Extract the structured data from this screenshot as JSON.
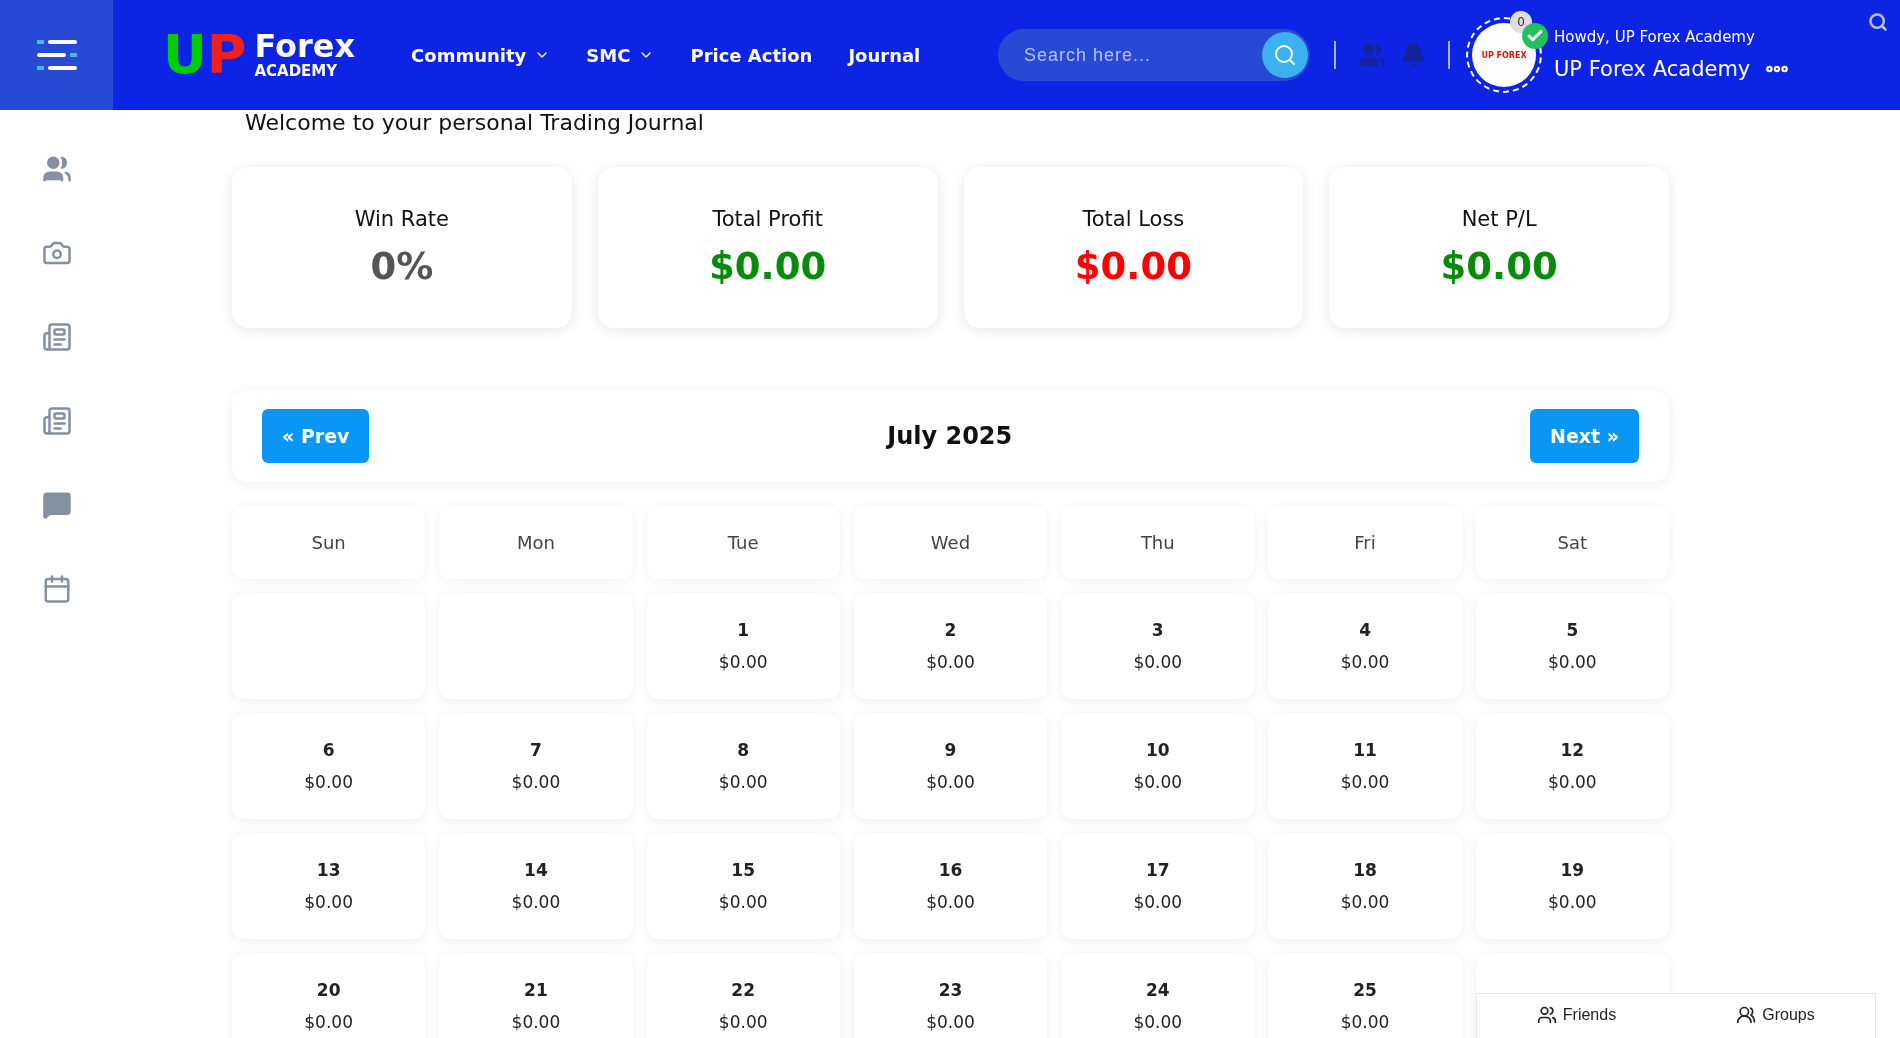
{
  "header": {
    "logo": {
      "mark_left": "U",
      "mark_right": "P",
      "word": "Forex",
      "sub": "ACADEMY"
    },
    "nav": [
      {
        "label": "Community",
        "dropdown": true
      },
      {
        "label": "SMC",
        "dropdown": true
      },
      {
        "label": "Price Action",
        "dropdown": false
      },
      {
        "label": "Journal",
        "dropdown": false
      }
    ],
    "search": {
      "placeholder": "Search here..."
    },
    "notification_count": "0",
    "verified": true,
    "greeting": "Howdy, UP Forex Academy",
    "user_name": "UP Forex Academy",
    "avatar_text": "UP FOREX"
  },
  "sidebar": {
    "items": [
      {
        "kind": "people"
      },
      {
        "kind": "camera"
      },
      {
        "kind": "news"
      },
      {
        "kind": "news"
      },
      {
        "kind": "chat"
      },
      {
        "kind": "calendar"
      }
    ]
  },
  "intro": "Welcome to your personal Trading Journal",
  "stats": [
    {
      "label": "Win Rate",
      "value": "0%",
      "color": "#555555"
    },
    {
      "label": "Total Profit",
      "value": "$0.00",
      "color": "#0a8a0a"
    },
    {
      "label": "Total Loss",
      "value": "$0.00",
      "color": "#ff0000"
    },
    {
      "label": "Net P/L",
      "value": "$0.00",
      "color": "#0a8a0a"
    }
  ],
  "calendar": {
    "prev": "« Prev",
    "month": "July 2025",
    "next": "Next »",
    "weekdays": [
      "Sun",
      "Mon",
      "Tue",
      "Wed",
      "Thu",
      "Fri",
      "Sat"
    ],
    "cells": [
      {},
      {},
      {
        "day": "1",
        "amount": "$0.00"
      },
      {
        "day": "2",
        "amount": "$0.00"
      },
      {
        "day": "3",
        "amount": "$0.00"
      },
      {
        "day": "4",
        "amount": "$0.00"
      },
      {
        "day": "5",
        "amount": "$0.00"
      },
      {
        "day": "6",
        "amount": "$0.00"
      },
      {
        "day": "7",
        "amount": "$0.00"
      },
      {
        "day": "8",
        "amount": "$0.00"
      },
      {
        "day": "9",
        "amount": "$0.00"
      },
      {
        "day": "10",
        "amount": "$0.00"
      },
      {
        "day": "11",
        "amount": "$0.00"
      },
      {
        "day": "12",
        "amount": "$0.00"
      },
      {
        "day": "13",
        "amount": "$0.00"
      },
      {
        "day": "14",
        "amount": "$0.00"
      },
      {
        "day": "15",
        "amount": "$0.00"
      },
      {
        "day": "16",
        "amount": "$0.00"
      },
      {
        "day": "17",
        "amount": "$0.00"
      },
      {
        "day": "18",
        "amount": "$0.00"
      },
      {
        "day": "19",
        "amount": "$0.00"
      },
      {
        "day": "20",
        "amount": "$0.00"
      },
      {
        "day": "21",
        "amount": "$0.00"
      },
      {
        "day": "22",
        "amount": "$0.00"
      },
      {
        "day": "23",
        "amount": "$0.00"
      },
      {
        "day": "24",
        "amount": "$0.00"
      },
      {
        "day": "25",
        "amount": "$0.00"
      },
      {}
    ]
  },
  "bottom_panel": {
    "tabs": [
      {
        "label": "Friends",
        "kind": "friends"
      },
      {
        "label": "Groups",
        "kind": "groups"
      }
    ]
  }
}
